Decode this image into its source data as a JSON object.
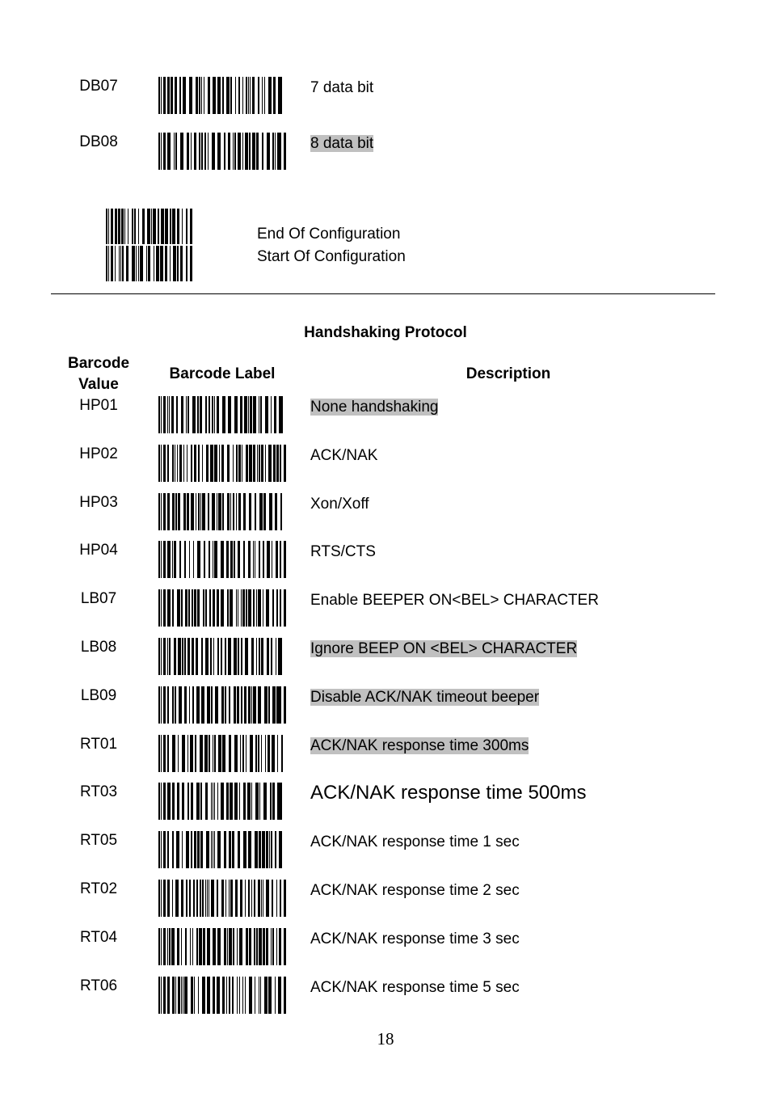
{
  "top_rows": [
    {
      "code": "DB07",
      "description": "7 data bit",
      "highlighted": false
    },
    {
      "code": "DB08",
      "description": "8 data bit",
      "highlighted": true
    }
  ],
  "config": {
    "line1": "End Of Configuration",
    "line2": "Start Of Configuration"
  },
  "section": {
    "title": "Handshaking Protocol",
    "headers": {
      "value_line1": "Barcode",
      "value_line2": "Value",
      "label": "Barcode Label",
      "description": "Description"
    },
    "rows": [
      {
        "code": "HP01",
        "description": "None handshaking",
        "highlighted": true
      },
      {
        "code": "HP02",
        "description": "ACK/NAK",
        "highlighted": false
      },
      {
        "code": "HP03",
        "description": "Xon/Xoff",
        "highlighted": false
      },
      {
        "code": "HP04",
        "description": "RTS/CTS",
        "highlighted": false
      },
      {
        "code": "LB07",
        "description": "Enable BEEPER ON<BEL> CHARACTER",
        "highlighted": false
      },
      {
        "code": "LB08",
        "description": "Ignore BEEP ON <BEL> CHARACTER",
        "highlighted": true
      },
      {
        "code": "LB09",
        "description": "Disable ACK/NAK timeout beeper",
        "highlighted": true
      },
      {
        "code": "RT01",
        "description": "ACK/NAK response time 300ms",
        "highlighted": true
      },
      {
        "code": "RT03",
        "description": "ACK/NAK response time 500ms",
        "highlighted": false,
        "large": true
      },
      {
        "code": "RT05",
        "description": "ACK/NAK response time 1 sec",
        "highlighted": false
      },
      {
        "code": "RT02",
        "description": "ACK/NAK response time 2 sec",
        "highlighted": false
      },
      {
        "code": "RT04",
        "description": "ACK/NAK response time 3 sec",
        "highlighted": false
      },
      {
        "code": "RT06",
        "description": "ACK/NAK response time 5 sec",
        "highlighted": false
      }
    ]
  },
  "page_number": "18",
  "colors": {
    "highlight": "#c0c0c0",
    "text": "#000000"
  }
}
